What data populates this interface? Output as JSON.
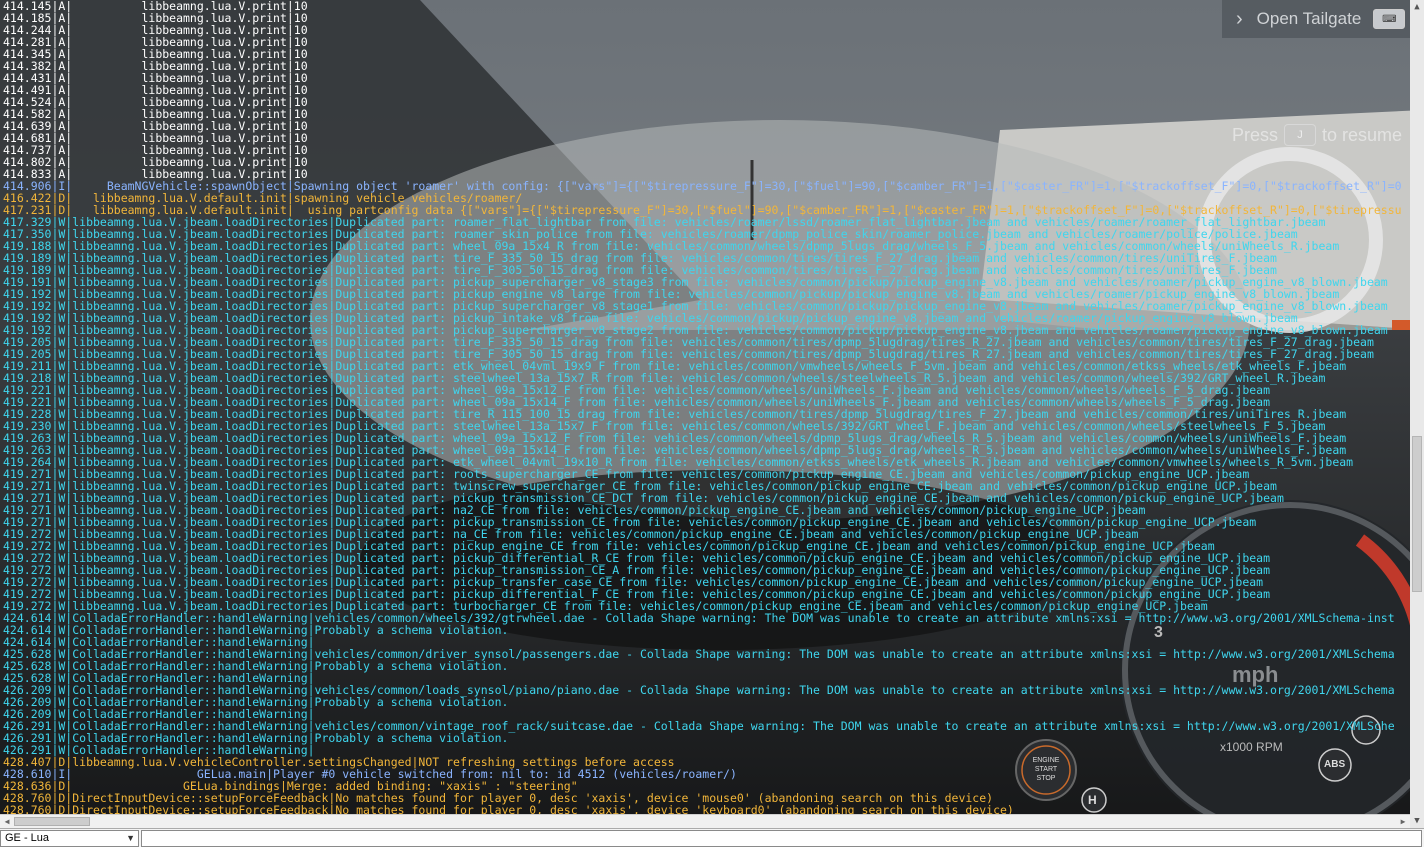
{
  "overlay": {
    "tailgate_label": "Open Tailgate",
    "resume_press": "Press",
    "resume_key": "J",
    "resume_text": "to resume"
  },
  "dash": {
    "gear": "3",
    "speed_unit": "mph",
    "rpm_label": "x1000 RPM",
    "engine_btn": [
      "ENGINE",
      "START",
      "STOP"
    ],
    "abs": "ABS",
    "h": "H"
  },
  "colors": {
    "A": "#ffffff",
    "I": "#8ab4ff",
    "D": "#f2b63a",
    "W": "#3fd6ee"
  },
  "console": {
    "lines": [
      {
        "lvl": "A",
        "text": "414.145|A|          libbeamng.lua.V.print|10"
      },
      {
        "lvl": "A",
        "text": "414.185|A|          libbeamng.lua.V.print|10"
      },
      {
        "lvl": "A",
        "text": "414.244|A|          libbeamng.lua.V.print|10"
      },
      {
        "lvl": "A",
        "text": "414.281|A|          libbeamng.lua.V.print|10"
      },
      {
        "lvl": "A",
        "text": "414.345|A|          libbeamng.lua.V.print|10"
      },
      {
        "lvl": "A",
        "text": "414.382|A|          libbeamng.lua.V.print|10"
      },
      {
        "lvl": "A",
        "text": "414.431|A|          libbeamng.lua.V.print|10"
      },
      {
        "lvl": "A",
        "text": "414.491|A|          libbeamng.lua.V.print|10"
      },
      {
        "lvl": "A",
        "text": "414.524|A|          libbeamng.lua.V.print|10"
      },
      {
        "lvl": "A",
        "text": "414.582|A|          libbeamng.lua.V.print|10"
      },
      {
        "lvl": "A",
        "text": "414.639|A|          libbeamng.lua.V.print|10"
      },
      {
        "lvl": "A",
        "text": "414.681|A|          libbeamng.lua.V.print|10"
      },
      {
        "lvl": "A",
        "text": "414.737|A|          libbeamng.lua.V.print|10"
      },
      {
        "lvl": "A",
        "text": "414.802|A|          libbeamng.lua.V.print|10"
      },
      {
        "lvl": "A",
        "text": "414.833|A|          libbeamng.lua.V.print|10"
      },
      {
        "lvl": "I",
        "text": "414.906|I|     BeamNGVehicle::spawnObject|Spawning object 'roamer' with config: {[\"vars\"]={[\"$tirepressure_F\"]=30,[\"$fuel\"]=90,[\"$camber_FR\"]=1,[\"$caster_FR\"]=1,[\"$trackoffset_F\"]=0,[\"$trackoffset_R\"]=0"
      },
      {
        "lvl": "D",
        "text": "416.422|D|   libbeamng.lua.V.default.init|spawning vehicle vehicles/roamer/"
      },
      {
        "lvl": "D",
        "text": "417.231|D|   libbeamng.lua.V.default.init|  using partconfig data {[\"vars\"]={[\"$tirepressure_F\"]=30,[\"$fuel\"]=90,[\"$camber_FR\"]=1,[\"$caster_FR\"]=1,[\"$trackoffset_F\"]=0,[\"$trackoffset_R\"]=0,[\"$tirepressu"
      },
      {
        "lvl": "W",
        "text": "417.329|W|libbeamng.lua.V.jbeam.loadDirectories|Duplicated part: roamer_flat_lightbar from file: vehicles/roamer/lssd/roamer_flat_lightbar.jbeam and vehicles/roamer/roamer_flat_lightbar.jbeam"
      },
      {
        "lvl": "W",
        "text": "417.350|W|libbeamng.lua.V.jbeam.loadDirectories|Duplicated part: roamer_skin_police from file: vehicles/roamer/dpmp_police_skin/roamer_police.jbeam and vehicles/roamer/police/police.jbeam"
      },
      {
        "lvl": "W",
        "text": "419.188|W|libbeamng.lua.V.jbeam.loadDirectories|Duplicated part: wheel_09a_15x4_R from file: vehicles/common/wheels/dpmp_5lugs_drag/wheels_F_5.jbeam and vehicles/common/wheels/uniWheels_R.jbeam"
      },
      {
        "lvl": "W",
        "text": "419.189|W|libbeamng.lua.V.jbeam.loadDirectories|Duplicated part: tire_F_335_50_15_drag from file: vehicles/common/tires/tires_F_27_drag.jbeam and vehicles/common/tires/uniTires_F.jbeam"
      },
      {
        "lvl": "W",
        "text": "419.189|W|libbeamng.lua.V.jbeam.loadDirectories|Duplicated part: tire_F_305_50_15_drag from file: vehicles/common/tires/tires_F_27_drag.jbeam and vehicles/common/tires/uniTires_F.jbeam"
      },
      {
        "lvl": "W",
        "text": "419.191|W|libbeamng.lua.V.jbeam.loadDirectories|Duplicated part: pickup_supercharger_v8_stage3 from file: vehicles/common/pickup/pickup_engine_v8.jbeam and vehicles/roamer/pickup_engine_v8_blown.jbeam"
      },
      {
        "lvl": "W",
        "text": "419.192|W|libbeamng.lua.V.jbeam.loadDirectories|Duplicated part: pickup_engine_v8_large from file: vehicles/common/pickup/pickup_engine_v8.jbeam and vehicles/roamer/pickup_engine_v8_blown.jbeam"
      },
      {
        "lvl": "W",
        "text": "419.192|W|libbeamng.lua.V.jbeam.loadDirectories|Duplicated part: pickup_supercharger_v8_stage1 from file: vehicles/common/pickup/pickup_engine_v8.jbeam and vehicles/roamer/pickup_engine_v8_blown.jbeam"
      },
      {
        "lvl": "W",
        "text": "419.192|W|libbeamng.lua.V.jbeam.loadDirectories|Duplicated part: pickup_intake_v8 from file: vehicles/common/pickup/pickup_engine_v8.jbeam and vehicles/roamer/pickup_engine_v8_blown.jbeam"
      },
      {
        "lvl": "W",
        "text": "419.192|W|libbeamng.lua.V.jbeam.loadDirectories|Duplicated part: pickup_supercharger_v8_stage2 from file: vehicles/common/pickup/pickup_engine_v8.jbeam and vehicles/roamer/pickup_engine_v8_blown.jbeam"
      },
      {
        "lvl": "W",
        "text": "419.205|W|libbeamng.lua.V.jbeam.loadDirectories|Duplicated part: tire_F_335_50_15_drag from file: vehicles/common/tires/dpmp_5lugdrag/tires_R_27.jbeam and vehicles/common/tires/tires_F_27_drag.jbeam"
      },
      {
        "lvl": "W",
        "text": "419.205|W|libbeamng.lua.V.jbeam.loadDirectories|Duplicated part: tire_F_305_50_15_drag from file: vehicles/common/tires/dpmp_5lugdrag/tires_R_27.jbeam and vehicles/common/tires/tires_F_27_drag.jbeam"
      },
      {
        "lvl": "W",
        "text": "419.211|W|libbeamng.lua.V.jbeam.loadDirectories|Duplicated part: etk_wheel_04vml_19x9_F from file: vehicles/common/vmwheels/wheels_F_5vm.jbeam and vehicles/common/etkss_wheels/etk_wheels_F.jbeam"
      },
      {
        "lvl": "W",
        "text": "419.218|W|libbeamng.lua.V.jbeam.loadDirectories|Duplicated part: steelwheel_13a_15x7_R from file: vehicles/common/wheels/steelwheels_R_5.jbeam and vehicles/common/wheels/392/GRT_wheel_R.jbeam"
      },
      {
        "lvl": "W",
        "text": "419.221|W|libbeamng.lua.V.jbeam.loadDirectories|Duplicated part: wheel_09a_15x12_F from file: vehicles/common/wheels/uniWheels_F.jbeam and vehicles/common/wheels/wheels_F_5_drag.jbeam"
      },
      {
        "lvl": "W",
        "text": "419.221|W|libbeamng.lua.V.jbeam.loadDirectories|Duplicated part: wheel_09a_15x14_F from file: vehicles/common/wheels/uniWheels_F.jbeam and vehicles/common/wheels/wheels_F_5_drag.jbeam"
      },
      {
        "lvl": "W",
        "text": "419.228|W|libbeamng.lua.V.jbeam.loadDirectories|Duplicated part: tire_R_115_100_15_drag from file: vehicles/common/tires/dpmp_5lugdrag/tires_F_27.jbeam and vehicles/common/tires/uniTires_R.jbeam"
      },
      {
        "lvl": "W",
        "text": "419.230|W|libbeamng.lua.V.jbeam.loadDirectories|Duplicated part: steelwheel_13a_15x7_F from file: vehicles/common/wheels/392/GRT_wheel_F.jbeam and vehicles/common/wheels/steelwheels_F_5.jbeam"
      },
      {
        "lvl": "W",
        "text": "419.263|W|libbeamng.lua.V.jbeam.loadDirectories|Duplicated part: wheel_09a_15x12_F from file: vehicles/common/wheels/dpmp_5lugs_drag/wheels_R_5.jbeam and vehicles/common/wheels/uniWheels_F.jbeam"
      },
      {
        "lvl": "W",
        "text": "419.263|W|libbeamng.lua.V.jbeam.loadDirectories|Duplicated part: wheel_09a_15x14_F from file: vehicles/common/wheels/dpmp_5lugs_drag/wheels_R_5.jbeam and vehicles/common/wheels/uniWheels_F.jbeam"
      },
      {
        "lvl": "W",
        "text": "419.264|W|libbeamng.lua.V.jbeam.loadDirectories|Duplicated part: etk_wheel_04vml_19x10_R from file: vehicles/common/etkss_wheels/etk_wheels_R.jbeam and vehicles/common/vmwheels/wheels_R_5vm.jbeam"
      },
      {
        "lvl": "W",
        "text": "419.271|W|libbeamng.lua.V.jbeam.loadDirectories|Duplicated part: roots_supercharger_CE from file: vehicles/common/pickup_engine_CE.jbeam and vehicles/common/pickup_engine_UCP.jbeam"
      },
      {
        "lvl": "W",
        "text": "419.271|W|libbeamng.lua.V.jbeam.loadDirectories|Duplicated part: twinscrew_supercharger_CE from file: vehicles/common/pickup_engine_CE.jbeam and vehicles/common/pickup_engine_UCP.jbeam"
      },
      {
        "lvl": "W",
        "text": "419.271|W|libbeamng.lua.V.jbeam.loadDirectories|Duplicated part: pickup_transmission_CE_DCT from file: vehicles/common/pickup_engine_CE.jbeam and vehicles/common/pickup_engine_UCP.jbeam"
      },
      {
        "lvl": "W",
        "text": "419.271|W|libbeamng.lua.V.jbeam.loadDirectories|Duplicated part: na2_CE from file: vehicles/common/pickup_engine_CE.jbeam and vehicles/common/pickup_engine_UCP.jbeam"
      },
      {
        "lvl": "W",
        "text": "419.271|W|libbeamng.lua.V.jbeam.loadDirectories|Duplicated part: pickup_transmission_CE from file: vehicles/common/pickup_engine_CE.jbeam and vehicles/common/pickup_engine_UCP.jbeam"
      },
      {
        "lvl": "W",
        "text": "419.272|W|libbeamng.lua.V.jbeam.loadDirectories|Duplicated part: na_CE from file: vehicles/common/pickup_engine_CE.jbeam and vehicles/common/pickup_engine_UCP.jbeam"
      },
      {
        "lvl": "W",
        "text": "419.272|W|libbeamng.lua.V.jbeam.loadDirectories|Duplicated part: pickup_engine_CE from file: vehicles/common/pickup_engine_CE.jbeam and vehicles/common/pickup_engine_UCP.jbeam"
      },
      {
        "lvl": "W",
        "text": "419.272|W|libbeamng.lua.V.jbeam.loadDirectories|Duplicated part: pickup_differential_R_CE from file: vehicles/common/pickup_engine_CE.jbeam and vehicles/common/pickup_engine_UCP.jbeam"
      },
      {
        "lvl": "W",
        "text": "419.272|W|libbeamng.lua.V.jbeam.loadDirectories|Duplicated part: pickup_transmission_CE_A from file: vehicles/common/pickup_engine_CE.jbeam and vehicles/common/pickup_engine_UCP.jbeam"
      },
      {
        "lvl": "W",
        "text": "419.272|W|libbeamng.lua.V.jbeam.loadDirectories|Duplicated part: pickup_transfer_case_CE from file: vehicles/common/pickup_engine_CE.jbeam and vehicles/common/pickup_engine_UCP.jbeam"
      },
      {
        "lvl": "W",
        "text": "419.272|W|libbeamng.lua.V.jbeam.loadDirectories|Duplicated part: pickup_differential_F_CE from file: vehicles/common/pickup_engine_CE.jbeam and vehicles/common/pickup_engine_UCP.jbeam"
      },
      {
        "lvl": "W",
        "text": "419.272|W|libbeamng.lua.V.jbeam.loadDirectories|Duplicated part: turbocharger_CE from file: vehicles/common/pickup_engine_CE.jbeam and vehicles/common/pickup_engine_UCP.jbeam"
      },
      {
        "lvl": "W",
        "text": "424.614|W|ColladaErrorHandler::handleWarning|vehicles/common/wheels/392/gtrwheel.dae - Collada Shape warning: The DOM was unable to create an attribute xmlns:xsi = http://www.w3.org/2001/XMLSchema-inst"
      },
      {
        "lvl": "W",
        "text": "424.614|W|ColladaErrorHandler::handleWarning|Probably a schema violation."
      },
      {
        "lvl": "W",
        "text": "424.614|W|ColladaErrorHandler::handleWarning|"
      },
      {
        "lvl": "W",
        "text": "425.628|W|ColladaErrorHandler::handleWarning|vehicles/common/driver_synsol/passengers.dae - Collada Shape warning: The DOM was unable to create an attribute xmlns:xsi = http://www.w3.org/2001/XMLSchema"
      },
      {
        "lvl": "W",
        "text": "425.628|W|ColladaErrorHandler::handleWarning|Probably a schema violation."
      },
      {
        "lvl": "W",
        "text": "425.628|W|ColladaErrorHandler::handleWarning|"
      },
      {
        "lvl": "W",
        "text": "426.209|W|ColladaErrorHandler::handleWarning|vehicles/common/loads_synsol/piano/piano.dae - Collada Shape warning: The DOM was unable to create an attribute xmlns:xsi = http://www.w3.org/2001/XMLSchema"
      },
      {
        "lvl": "W",
        "text": "426.209|W|ColladaErrorHandler::handleWarning|Probably a schema violation."
      },
      {
        "lvl": "W",
        "text": "426.209|W|ColladaErrorHandler::handleWarning|"
      },
      {
        "lvl": "W",
        "text": "426.291|W|ColladaErrorHandler::handleWarning|vehicles/common/vintage_roof_rack/suitcase.dae - Collada Shape warning: The DOM was unable to create an attribute xmlns:xsi = http://www.w3.org/2001/XMLSche"
      },
      {
        "lvl": "W",
        "text": "426.291|W|ColladaErrorHandler::handleWarning|Probably a schema violation."
      },
      {
        "lvl": "W",
        "text": "426.291|W|ColladaErrorHandler::handleWarning|"
      },
      {
        "lvl": "D",
        "text": "428.407|D|libbeamng.lua.V.vehicleController.settingsChanged|NOT refreshing settings before access"
      },
      {
        "lvl": "I",
        "text": "428.610|I|                  GELua.main|Player #0 vehicle switched from: nil to: id 4512 (vehicles/roamer/)"
      },
      {
        "lvl": "D",
        "text": "428.636|D|                GELua.bindings|Merge: added binding: \"xaxis\" : \"steering\""
      },
      {
        "lvl": "D",
        "text": "428.760|D|DirectInputDevice::setupForceFeedback|No matches found for player 0, desc 'xaxis', device 'mouse0' (abandoning search on this device)"
      },
      {
        "lvl": "D",
        "text": "428.760|D|DirectInputDevice::setupForceFeedback|No matches found for player 0, desc 'xaxis', device 'keyboard0' (abandoning search on this device)"
      }
    ]
  },
  "bottom_bar": {
    "context_value": "GE - Lua",
    "input_value": ""
  }
}
